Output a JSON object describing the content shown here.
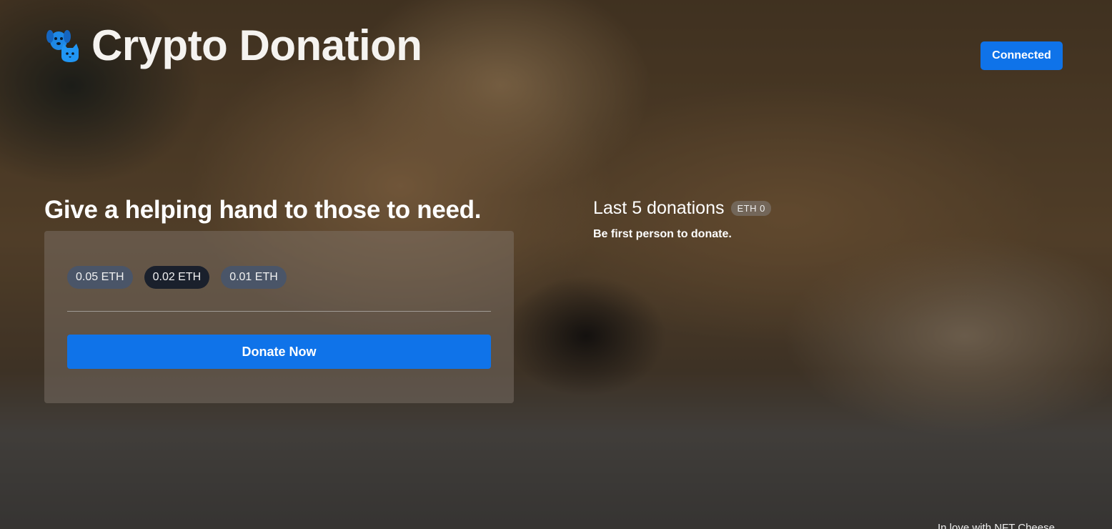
{
  "header": {
    "logo_icon": "dog-cat-paw-icon",
    "title": "Crypto Donation",
    "connect_label": "Connected"
  },
  "hero": {
    "heading": "Give a helping hand to those to need."
  },
  "donation_panel": {
    "amounts": [
      "0.05 ETH",
      "0.02 ETH",
      "0.01 ETH"
    ],
    "selected_index": 1,
    "donate_label": "Donate Now"
  },
  "recent_donations": {
    "title": "Last 5 donations",
    "total_badge": "ETH 0",
    "empty_message": "Be first person to donate."
  },
  "footer": {
    "text": "In love with NFT Cheese"
  },
  "colors": {
    "accent": "#0f73e9",
    "chip_light": "#4a5568",
    "chip_dark": "#1a202c"
  }
}
